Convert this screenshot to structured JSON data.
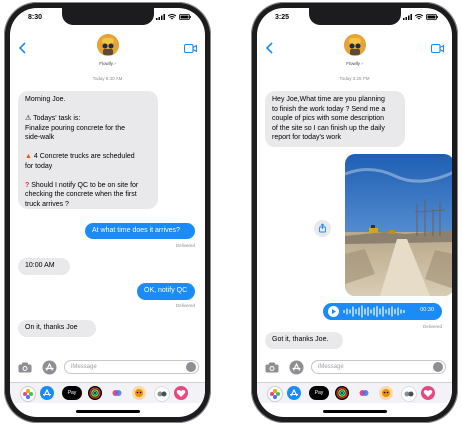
{
  "left": {
    "time": "8:30",
    "contact_name": "Flowlly",
    "timestamp": "Today 8:30 AM",
    "messages": {
      "m1_l1": "Morning Joe.",
      "m1_l2": "Todays' task is:",
      "m1_l3": "Finalize pouring concrete for the",
      "m1_l4": "side-walk",
      "m1_l5": "4 Concrete trucks are scheduled",
      "m1_l6": "for today",
      "m1_l7": "Should I notify QC to be on site for",
      "m1_l8": "checking the concrete when the first",
      "m1_l9": "truck arrives ?",
      "m2": "At what time does it arrives?",
      "m3": "10:00 AM",
      "m4": "OK, notify QC",
      "m5": "On it, thanks Joe"
    },
    "delivered1": "Delivered",
    "delivered2": "Delivered",
    "placeholder": "iMessage"
  },
  "right": {
    "time": "3:25",
    "contact_name": "Flowlly",
    "timestamp": "Today 3:25 PM",
    "messages": {
      "m1_l1": "Hey Joe,What time are you planning",
      "m1_l2": "to finish the work today ? Send me a",
      "m1_l3": "couple of pics with some description",
      "m1_l4": "of the site so I can finish up the daily",
      "m1_l5": "report for today's work",
      "m2": "Got it, thanks Joe."
    },
    "voice_duration": "00:30",
    "delivered": "Delivered",
    "placeholder": "iMessage"
  },
  "icons": {
    "warning": "warning-icon",
    "fire": "fire-icon",
    "question": "question-icon",
    "share": "share-icon",
    "apple_pay_label": "Pay"
  },
  "colors": {
    "accent": "#1b8bf7",
    "incoming": "#e9e9eb"
  }
}
